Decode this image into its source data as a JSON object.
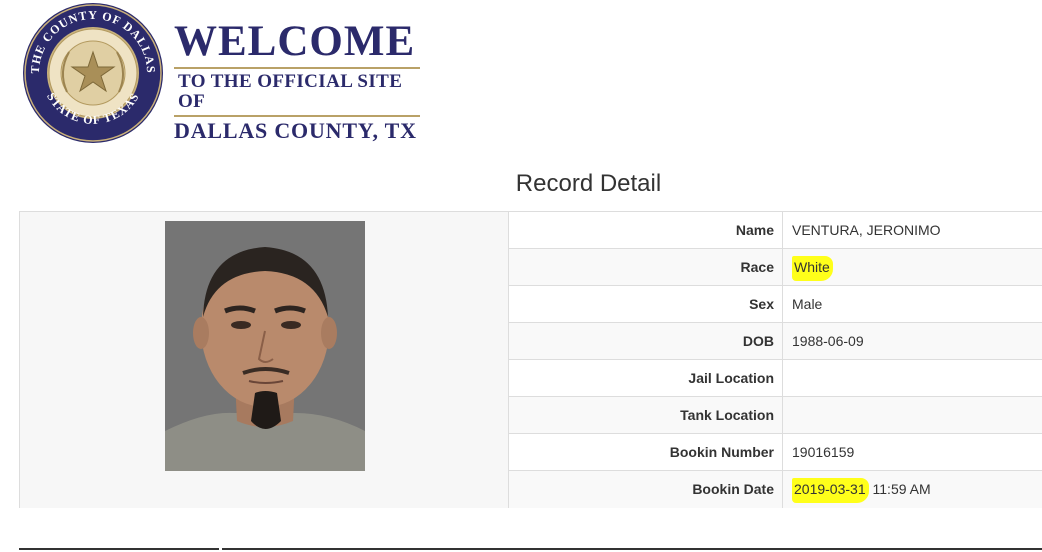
{
  "header": {
    "seal_top_text": "THE COUNTY OF DALLAS",
    "seal_bottom_text": "STATE OF TEXAS",
    "welcome": "WELCOME",
    "subtitle": "TO THE OFFICIAL SITE OF",
    "county": "DALLAS COUNTY, TX"
  },
  "page_title": "Record Detail",
  "record": {
    "rows": [
      {
        "label": "Name",
        "value": "VENTURA, JERONIMO"
      },
      {
        "label": "Race",
        "value": "White"
      },
      {
        "label": "Sex",
        "value": "Male"
      },
      {
        "label": "DOB",
        "value": "1988-06-09"
      },
      {
        "label": "Jail Location",
        "value": ""
      },
      {
        "label": "Tank Location",
        "value": ""
      },
      {
        "label": "Bookin Number",
        "value": "19016159"
      },
      {
        "label": "Bookin Date",
        "value_date": "2019-03-31",
        "value_time": " 11:59 AM"
      }
    ]
  },
  "colors": {
    "brand_navy": "#2b2a6b",
    "seal_gold": "#b9a167",
    "highlight": "#ffff1a"
  }
}
